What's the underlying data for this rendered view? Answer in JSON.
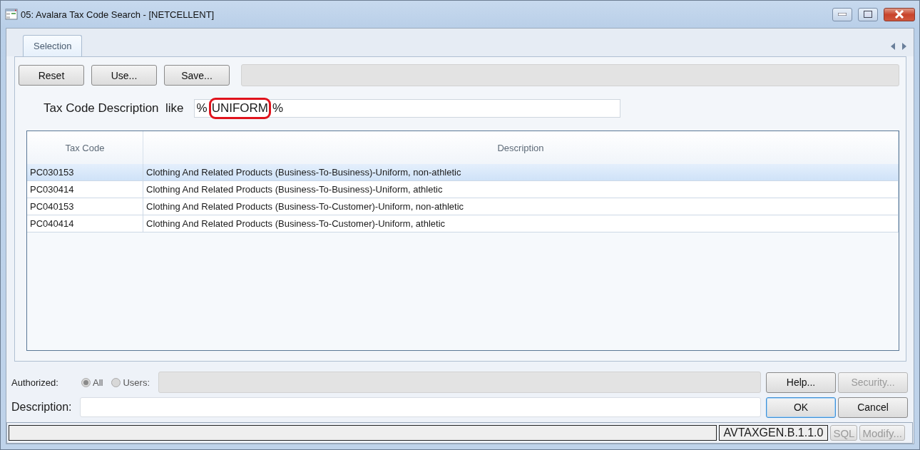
{
  "window": {
    "title": "05:  Avalara Tax Code Search - [NETCELLENT]"
  },
  "tabs": [
    {
      "label": "Selection",
      "selected": true
    }
  ],
  "toolbar": {
    "buttons": [
      {
        "label": "Reset"
      },
      {
        "label": "Use..."
      },
      {
        "label": "Save..."
      }
    ]
  },
  "filter": {
    "label": "Tax Code Description  like",
    "value_before": "%",
    "value_marked": "UNIFORM",
    "value_after": "%"
  },
  "table": {
    "columns": [
      "Tax Code",
      "Description"
    ],
    "rows": [
      {
        "code": "PC030153",
        "description": "Clothing And Related Products (Business-To-Business)-Uniform, non-athletic",
        "selected": true
      },
      {
        "code": "PC030414",
        "description": "Clothing And Related Products (Business-To-Business)-Uniform, athletic",
        "selected": false
      },
      {
        "code": "PC040153",
        "description": "Clothing And Related Products (Business-To-Customer)-Uniform, non-athletic",
        "selected": false
      },
      {
        "code": "PC040414",
        "description": "Clothing And Related Products (Business-To-Customer)-Uniform, athletic",
        "selected": false
      }
    ]
  },
  "authorized": {
    "label": "Authorized:",
    "options": [
      {
        "label": "All",
        "selected": true
      },
      {
        "label": "Users:",
        "selected": false
      }
    ]
  },
  "description": {
    "label": "Description:"
  },
  "buttons": [
    {
      "label": "Help...",
      "disabled": false,
      "default": false
    },
    {
      "label": "Security...",
      "disabled": true,
      "default": false
    },
    {
      "label": "OK",
      "disabled": false,
      "default": true
    },
    {
      "label": "Cancel",
      "disabled": false,
      "default": false
    }
  ],
  "status_bar": {
    "version": "AVTAXGEN.B.1.1.0",
    "buttons": [
      {
        "label": "SQL",
        "disabled": true
      },
      {
        "label": "Modify...",
        "disabled": true
      }
    ]
  }
}
